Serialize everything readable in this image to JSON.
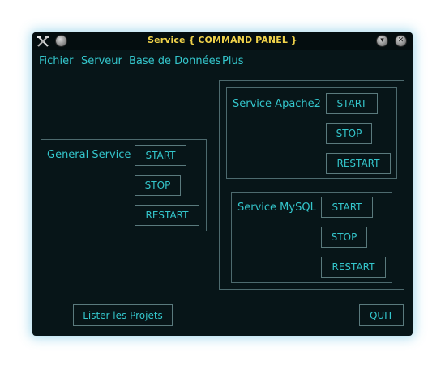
{
  "window": {
    "title": "Service { COMMAND PANEL }"
  },
  "menu": {
    "items": [
      {
        "label": "Fichier"
      },
      {
        "label": "Serveur"
      },
      {
        "label": "Base de Données"
      },
      {
        "label": "Plus"
      }
    ]
  },
  "general_service": {
    "label": "General Service",
    "start": "START",
    "stop": "STOP",
    "restart": "RESTART"
  },
  "apache": {
    "label": "Service Apache2",
    "start": "START",
    "stop": "STOP",
    "restart": "RESTART"
  },
  "mysql": {
    "label": "Service MySQL",
    "start": "START",
    "stop": "STOP",
    "restart": "RESTART"
  },
  "footer": {
    "list_projects": "Lister les Projets",
    "quit": "QUIT"
  },
  "colors": {
    "background": "#071518",
    "text_accent": "#34c6cc",
    "title": "#f0d24a",
    "border": "#4d6a6e"
  }
}
